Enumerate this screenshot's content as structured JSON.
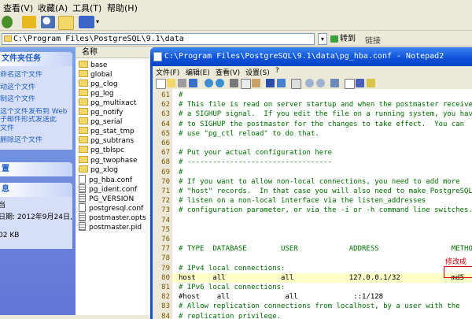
{
  "explorer": {
    "menu": [
      "查看(V)",
      "收藏(A)",
      "工具(T)",
      "帮助(H)"
    ],
    "address": "C:\\Program Files\\PostgreSQL\\9.1\\data",
    "go_label": "转到",
    "links_label": "链接",
    "tasks_header": "文件夹任务",
    "tasks": [
      "命名这个文件",
      "动这个文件",
      "制这个文件",
      "这个文件发布到 Web",
      "子邮件形式发送此",
      "文件",
      "删除这个文件"
    ],
    "other_header": "置",
    "details_header": "息",
    "details": [
      "当",
      "日期: 2012年9月24日,",
      "02 KB"
    ],
    "name_column": "名称",
    "files": [
      {
        "name": "base",
        "type": "folder"
      },
      {
        "name": "global",
        "type": "folder"
      },
      {
        "name": "pg_clog",
        "type": "folder"
      },
      {
        "name": "pg_log",
        "type": "folder"
      },
      {
        "name": "pg_multixact",
        "type": "folder"
      },
      {
        "name": "pg_notify",
        "type": "folder"
      },
      {
        "name": "pg_serial",
        "type": "folder"
      },
      {
        "name": "pg_stat_tmp",
        "type": "folder"
      },
      {
        "name": "pg_subtrans",
        "type": "folder"
      },
      {
        "name": "pg_tblspc",
        "type": "folder"
      },
      {
        "name": "pg_twophase",
        "type": "folder"
      },
      {
        "name": "pg_xlog",
        "type": "folder"
      },
      {
        "name": "pg_hba.conf",
        "type": "file"
      },
      {
        "name": "pg_ident.conf",
        "type": "file"
      },
      {
        "name": "PG_VERSION",
        "type": "file"
      },
      {
        "name": "postgresql.conf",
        "type": "file"
      },
      {
        "name": "postmaster.opts",
        "type": "file"
      },
      {
        "name": "postmaster.pid",
        "type": "file"
      }
    ]
  },
  "notepad": {
    "title": "C:\\Program Files\\PostgreSQL\\9.1\\data\\pg_hba.conf - Notepad2",
    "menu": [
      "文件(F)",
      "编辑(E)",
      "查看(V)",
      "设置(S)",
      "?"
    ],
    "lines": [
      {
        "n": "61",
        "text": "#",
        "kind": "comment"
      },
      {
        "n": "62",
        "text": "# This file is read on server startup and when the postmaster receive",
        "kind": "comment"
      },
      {
        "n": "63",
        "text": "# a SIGHUP signal.  If you edit the file on a running system, you hav",
        "kind": "comment"
      },
      {
        "n": "64",
        "text": "# to SIGHUP the postmaster for the changes to take effect.  You can",
        "kind": "comment"
      },
      {
        "n": "65",
        "text": "# use \"pg_ctl reload\" to do that.",
        "kind": "comment"
      },
      {
        "n": "66",
        "text": "",
        "kind": "comment"
      },
      {
        "n": "67",
        "text": "# Put your actual configuration here",
        "kind": "comment"
      },
      {
        "n": "68",
        "text": "# ----------------------------------",
        "kind": "comment"
      },
      {
        "n": "69",
        "text": "#",
        "kind": "comment"
      },
      {
        "n": "70",
        "text": "# If you want to allow non-local connections, you need to add more",
        "kind": "comment"
      },
      {
        "n": "71",
        "text": "# \"host\" records.  In that case you will also need to make PostgreSQL",
        "kind": "comment"
      },
      {
        "n": "72",
        "text": "# listen on a non-local interface via the listen_addresses",
        "kind": "comment"
      },
      {
        "n": "73",
        "text": "# configuration parameter, or via the -i or -h command line switches.",
        "kind": "comment"
      },
      {
        "n": "74",
        "text": "",
        "kind": "comment"
      },
      {
        "n": "75",
        "text": "",
        "kind": "comment"
      },
      {
        "n": "76",
        "text": "",
        "kind": "comment"
      },
      {
        "n": "77",
        "text": "# TYPE  DATABASE        USER            ADDRESS                 METHO",
        "kind": "comment"
      },
      {
        "n": "78",
        "text": "",
        "kind": "comment"
      },
      {
        "n": "79",
        "text": "# IPv4 local connections:",
        "kind": "comment"
      },
      {
        "n": "80",
        "text": "host    all             all             127.0.0.1/32            md5",
        "kind": "code"
      },
      {
        "n": "81",
        "text": "# IPv6 local connections:",
        "kind": "comment"
      },
      {
        "n": "82",
        "text": "#host    all             all             ::1/128",
        "kind": "code"
      },
      {
        "n": "83",
        "text": "# Allow replication connections from localhost, by a user with the",
        "kind": "comment"
      },
      {
        "n": "84",
        "text": "# replication privilege.",
        "kind": "comment"
      }
    ],
    "annotation": "修改成"
  }
}
